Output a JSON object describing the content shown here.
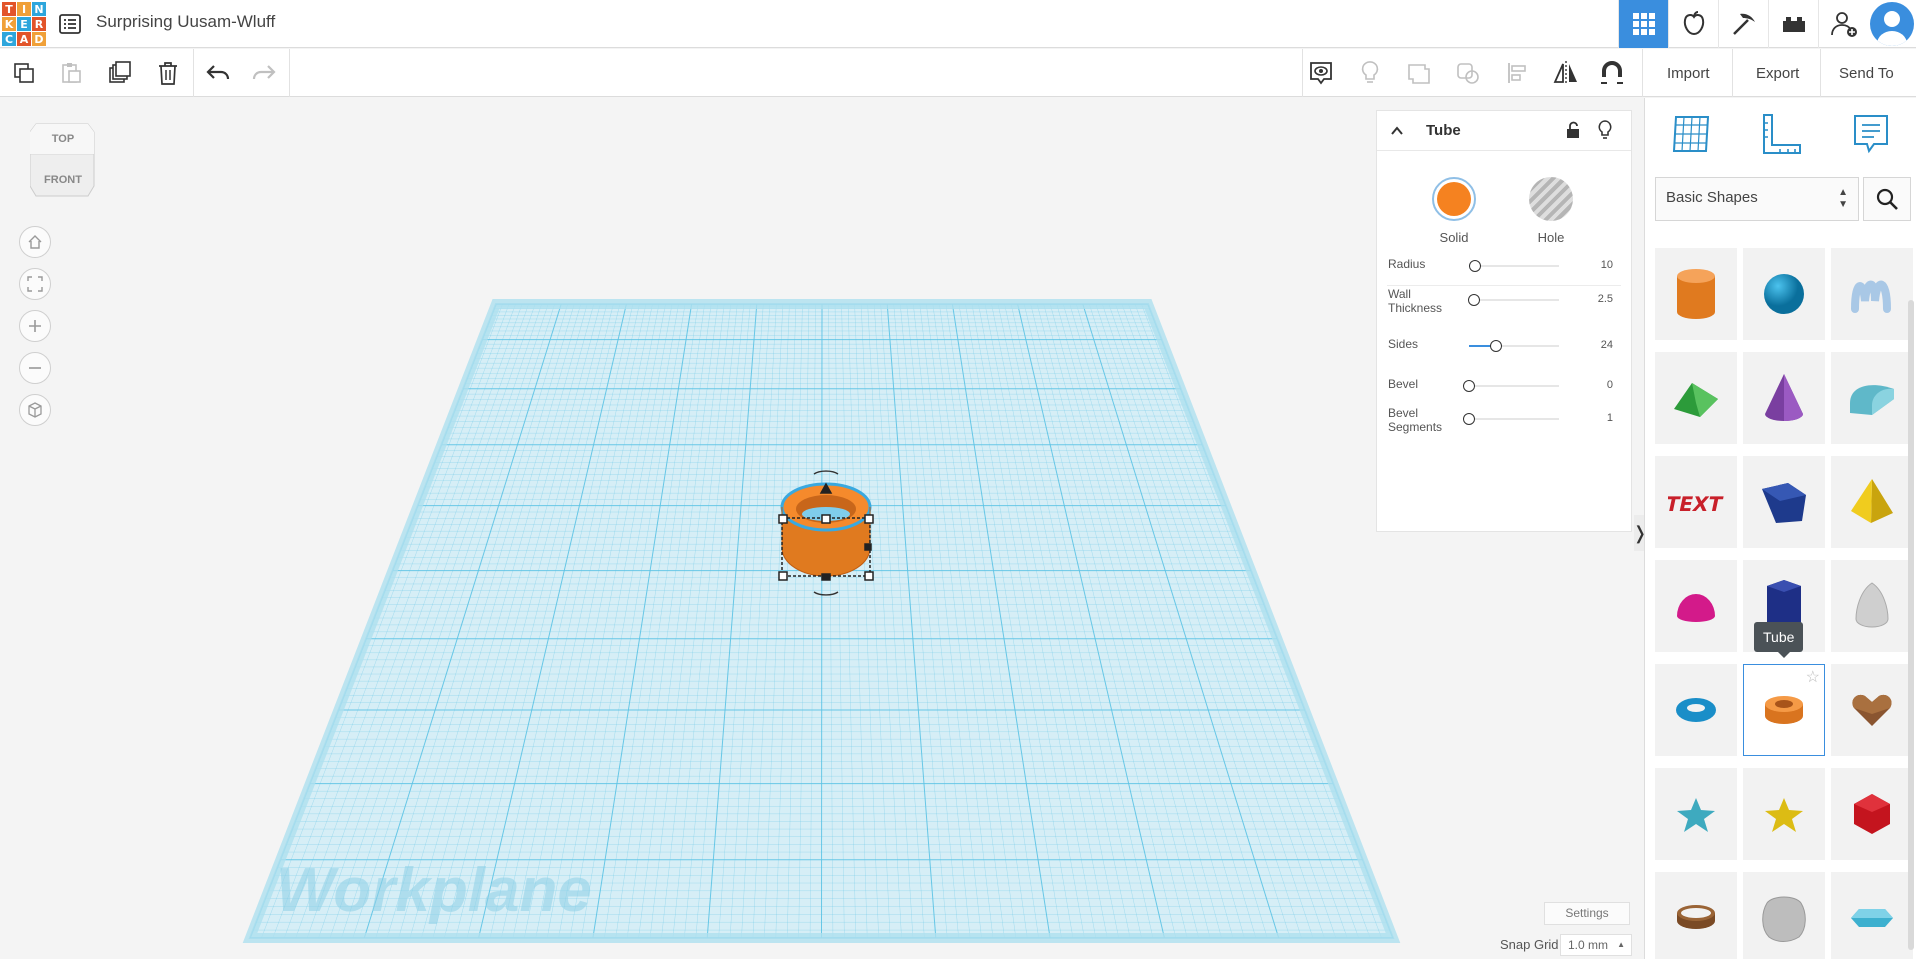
{
  "app": {
    "logo_letters": [
      "T",
      "I",
      "N",
      "K",
      "E",
      "R",
      "C",
      "A",
      "D"
    ],
    "logo_colors": [
      "#e2542a",
      "#f0a038",
      "#2ea6dc",
      "#f0a038",
      "#2ea6dc",
      "#e2542a",
      "#2ea6dc",
      "#e2542a",
      "#f0a038"
    ],
    "design_title": "Surprising Uusam-Wluff"
  },
  "toolbar": {
    "import_label": "Import",
    "export_label": "Export",
    "send_to_label": "Send To"
  },
  "viewcube": {
    "top_label": "TOP",
    "front_label": "FRONT"
  },
  "workplane": {
    "label": "Workplane",
    "grid_color": "#5cc3e5"
  },
  "inspector": {
    "title": "Tube",
    "solid_label": "Solid",
    "hole_label": "Hole",
    "solid_color": "#f58220",
    "props": [
      {
        "label": "Radius",
        "value": "10",
        "fraction": 0.07
      },
      {
        "label": "Wall Thickness",
        "value": "2.5",
        "fraction": 0.05
      },
      {
        "label": "Sides",
        "value": "24",
        "fraction": 0.3
      },
      {
        "label": "Bevel",
        "value": "0",
        "fraction": 0.0
      },
      {
        "label": "Bevel Segments",
        "value": "1",
        "fraction": 0.0
      }
    ]
  },
  "shapes_panel": {
    "category": "Basic Shapes",
    "tooltip": "Tube",
    "items": [
      "cylinder",
      "sphere",
      "scribble",
      "roof",
      "cone",
      "round-roof",
      "text",
      "box-rotated",
      "pyramid",
      "half-sphere",
      "polygon",
      "paraboloid",
      "torus",
      "tube",
      "heart",
      "star",
      "star-yellow",
      "icosahedron",
      "ring",
      "rounded-box",
      "hexagon-flat"
    ]
  },
  "footer": {
    "settings_label": "Settings",
    "snap_grid_label": "Snap Grid",
    "snap_grid_value": "1.0 mm"
  }
}
